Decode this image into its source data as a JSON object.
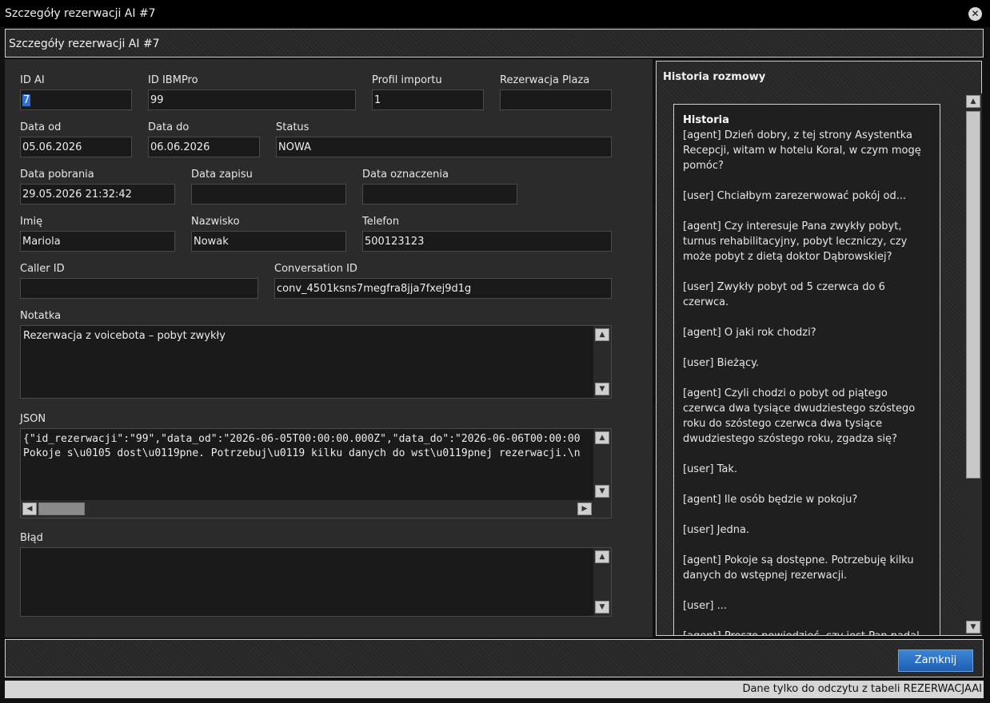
{
  "window": {
    "title": "Szczegóły rezerwacji AI #7",
    "close_icon": "close-icon"
  },
  "header": {
    "title": "Szczegóły rezerwacji AI #7"
  },
  "form": {
    "id_ai": {
      "label": "ID AI",
      "value": "7"
    },
    "id_ibmpro": {
      "label": "ID IBMPro",
      "value": "99"
    },
    "profil_importu": {
      "label": "Profil importu",
      "value": "1"
    },
    "rezerwacja_plaza": {
      "label": "Rezerwacja Plaza",
      "value": ""
    },
    "data_od": {
      "label": "Data od",
      "value": "05.06.2026"
    },
    "data_do": {
      "label": "Data do",
      "value": "06.06.2026"
    },
    "status": {
      "label": "Status",
      "value": "NOWA"
    },
    "data_pobrania": {
      "label": "Data pobrania",
      "value": "29.05.2026 21:32:42"
    },
    "data_zapisu": {
      "label": "Data zapisu",
      "value": ""
    },
    "data_oznaczenia": {
      "label": "Data oznaczenia",
      "value": ""
    },
    "imie": {
      "label": "Imię",
      "value": "Mariola"
    },
    "nazwisko": {
      "label": "Nazwisko",
      "value": "Nowak"
    },
    "telefon": {
      "label": "Telefon",
      "value": "500123123"
    },
    "caller_id": {
      "label": "Caller ID",
      "value": ""
    },
    "conversation_id": {
      "label": "Conversation ID",
      "value": "conv_4501ksns7megfra8jja7fxej9d1g"
    },
    "notatka": {
      "label": "Notatka",
      "value": "Rezerwacja z voicebota – pobyt zwykły"
    },
    "json": {
      "label": "JSON",
      "line1": "{\"id_rezerwacji\":\"99\",\"data_od\":\"2026-06-05T00:00:00.000Z\",\"data_do\":\"2026-06-06T00:00:00",
      "line2": "Pokoje s\\u0105 dost\\u0119pne. Potrzebuj\\u0119 kilku danych do wst\\u0119pnej rezerwacji.\\n"
    },
    "blad": {
      "label": "Błąd",
      "value": ""
    }
  },
  "history": {
    "heading": "Historia rozmowy",
    "title": "Historia",
    "messages": [
      "[agent] Dzień dobry, z tej strony Asystentka Recepcji, witam w hotelu Koral, w czym mogę pomóc?",
      "[user] Chciałbym zarezerwować pokój od...",
      "[agent] Czy interesuje Pana zwykły pobyt, turnus rehabilitacyjny, pobyt leczniczy, czy może pobyt z dietą doktor Dąbrowskiej?",
      "[user] Zwykły pobyt od 5 czerwca do 6 czerwca.",
      "[agent] O jaki rok chodzi?",
      "[user] Bieżący.",
      "[agent] Czyli chodzi o pobyt od piątego czerwca dwa tysiące dwudziestego szóstego roku do szóstego czerwca dwa tysiące dwudziestego szóstego roku, zgadza się?",
      "[user] Tak.",
      "[agent] Ile osób będzie w pokoju?",
      "[user] Jedna.",
      "[agent] Pokoje są dostępne. Potrzebuję kilku danych do wstępnej rezerwacji.",
      "[user] ...",
      "[agent] Proszę powiedzieć, czy jest Pan nadal ze mną?"
    ]
  },
  "footer": {
    "close_button": "Zamknij"
  },
  "status_bar": {
    "text": "Dane tylko do odczytu z tabeli REZERWACJAAI"
  },
  "colors": {
    "accent": "#2f6fcf",
    "button": "#2b73c8",
    "background": "#2b2b2b"
  }
}
